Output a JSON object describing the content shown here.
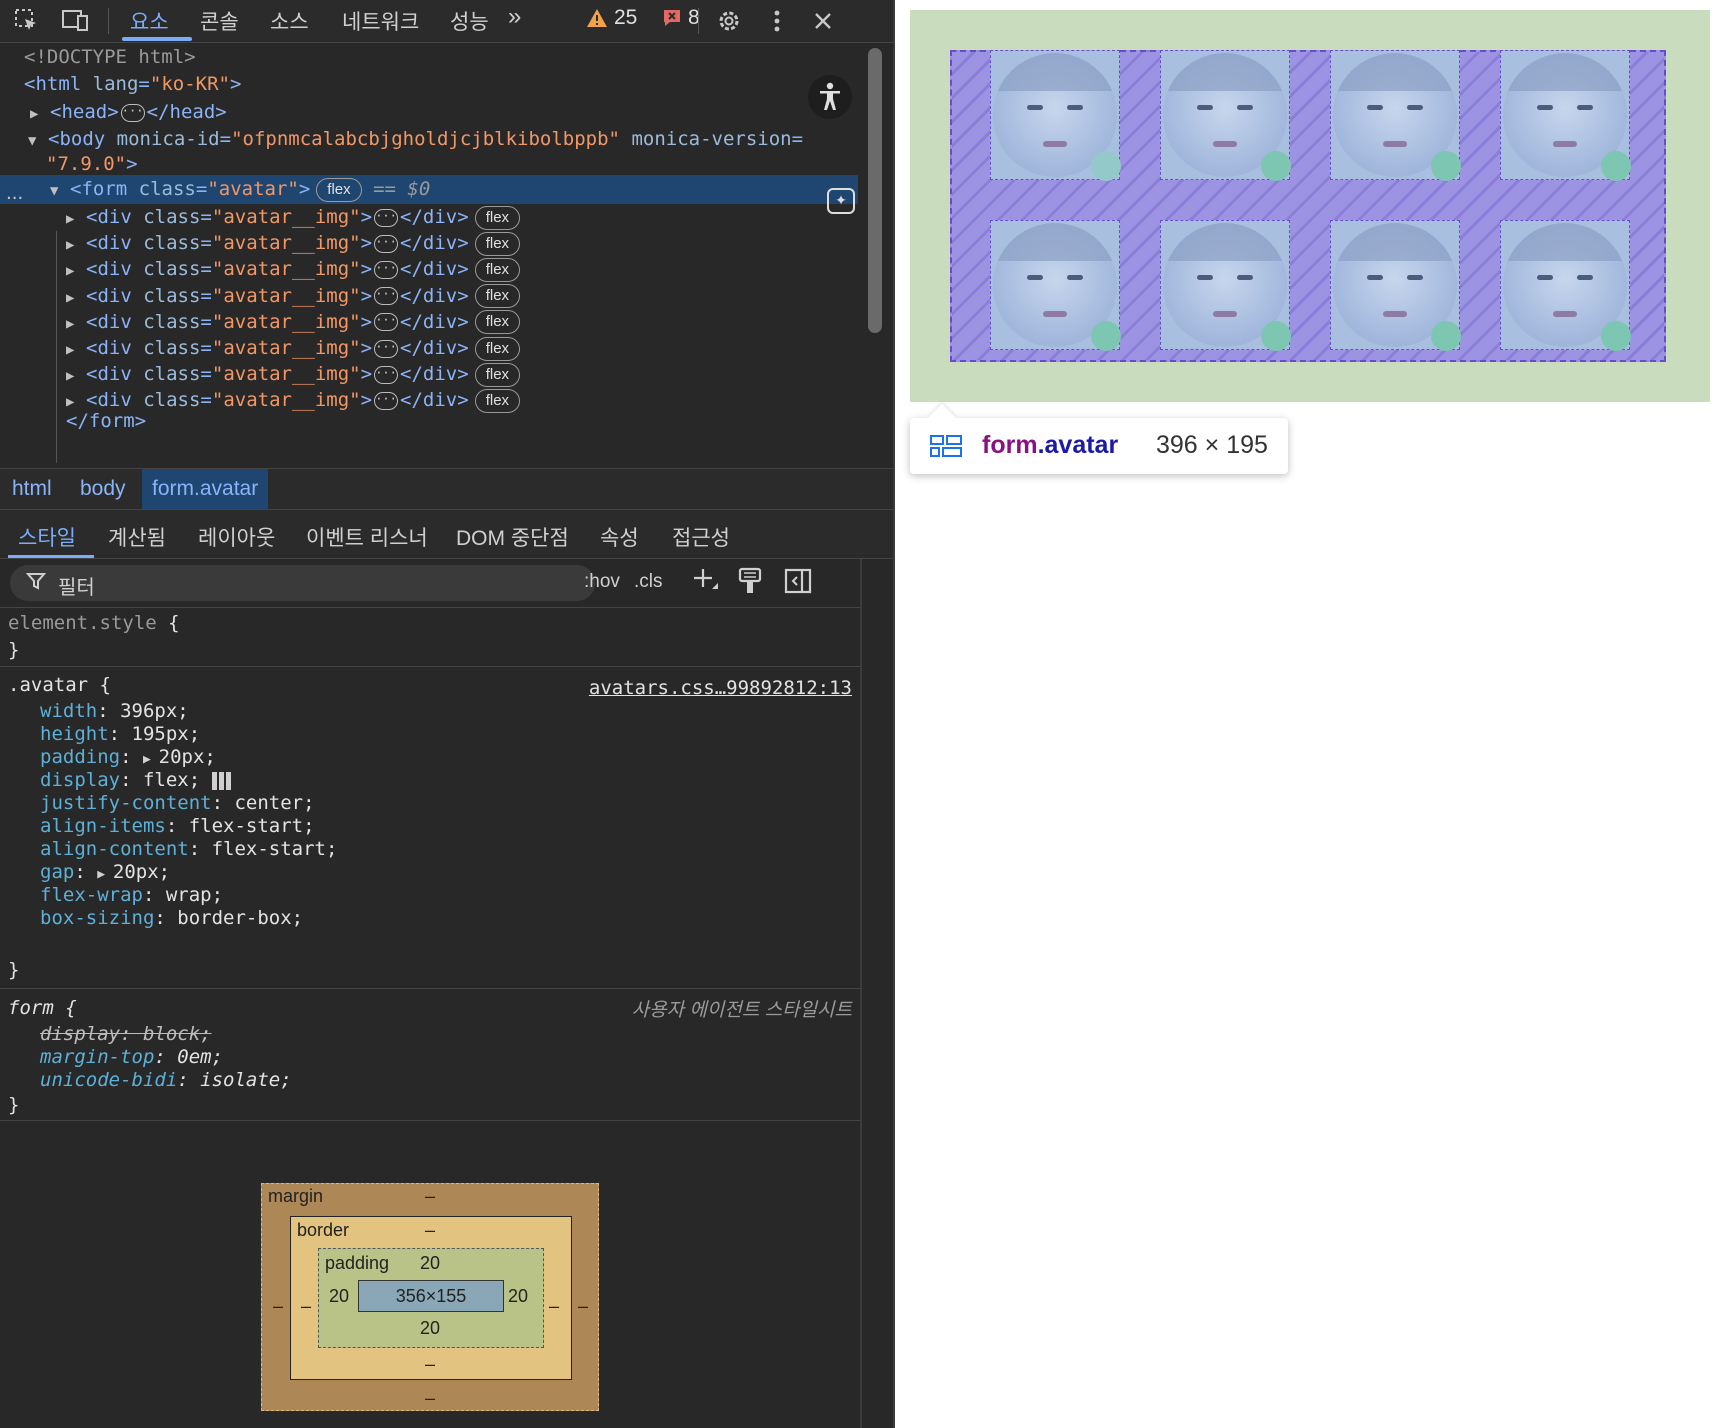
{
  "toolbar": {
    "tabs": [
      "요소",
      "콘솔",
      "소스",
      "네트워크",
      "성능"
    ],
    "more_label": "»",
    "warnings": "25",
    "errors": "8"
  },
  "dom": {
    "doctype": "<!DOCTYPE html>",
    "html_open_tag": "<html",
    "html_attr": "lang",
    "html_attr_val": "\"ko-KR\"",
    "head_open": "<head>",
    "head_close": "</head>",
    "body_open": "<body",
    "body_attr1": "monica-id",
    "body_attr1_val": "\"ofpnmcalabcbjgholdjcjblkibolbppb\"",
    "body_attr2": "monica-version",
    "body_attr2_val": "\"7.9.0\"",
    "form_open": "<form",
    "form_attr": "class",
    "form_attr_val": "\"avatar\"",
    "form_badge": "flex",
    "selected_marker": "== $0",
    "child_open": "<div",
    "child_attr": "class",
    "child_attr_val": "\"avatar__img\"",
    "child_close": "</div>",
    "child_badge": "flex",
    "form_close": "</form>"
  },
  "breadcrumb": [
    "html",
    "body",
    "form.avatar"
  ],
  "subtabs": [
    "스타일",
    "계산됨",
    "레이아웃",
    "이벤트 리스너",
    "DOM 중단점",
    "속성",
    "접근성"
  ],
  "filter": {
    "placeholder": "필터",
    "hov": ":hov",
    "cls": ".cls"
  },
  "styles": {
    "element_style": "element.style",
    "avatar_selector": ".avatar",
    "avatar_source": "avatars.css…99892812:13",
    "avatar_props": [
      {
        "name": "width",
        "value": "396px;"
      },
      {
        "name": "height",
        "value": "195px;"
      },
      {
        "name": "padding",
        "value": "20px;"
      },
      {
        "name": "display",
        "value": "flex;"
      },
      {
        "name": "justify-content",
        "value": "center;"
      },
      {
        "name": "align-items",
        "value": "flex-start;"
      },
      {
        "name": "align-content",
        "value": "flex-start;"
      },
      {
        "name": "gap",
        "value": "20px;"
      },
      {
        "name": "flex-wrap",
        "value": "wrap;"
      },
      {
        "name": "box-sizing",
        "value": "border-box;"
      }
    ],
    "form_selector": "form",
    "form_source": "사용자 에이전트 스타일시트",
    "form_props": [
      {
        "name": "display",
        "value": "block;"
      },
      {
        "name": "margin-top",
        "value": "0em;"
      },
      {
        "name": "unicode-bidi",
        "value": "isolate;"
      }
    ]
  },
  "box_model": {
    "margin_label": "margin",
    "border_label": "border",
    "padding_label": "padding",
    "dash": "–",
    "padding_top": "20",
    "padding_right": "20",
    "padding_bottom": "20",
    "padding_left": "20",
    "content": "356×155"
  },
  "tooltip": {
    "tag": "form",
    "cls": ".avatar",
    "size": "396 × 195"
  },
  "colors": {
    "accent": "#7cacf8",
    "selection": "#1f4670",
    "page_bg": "#c9ddbe",
    "flex_overlay": "#9d93e3"
  }
}
